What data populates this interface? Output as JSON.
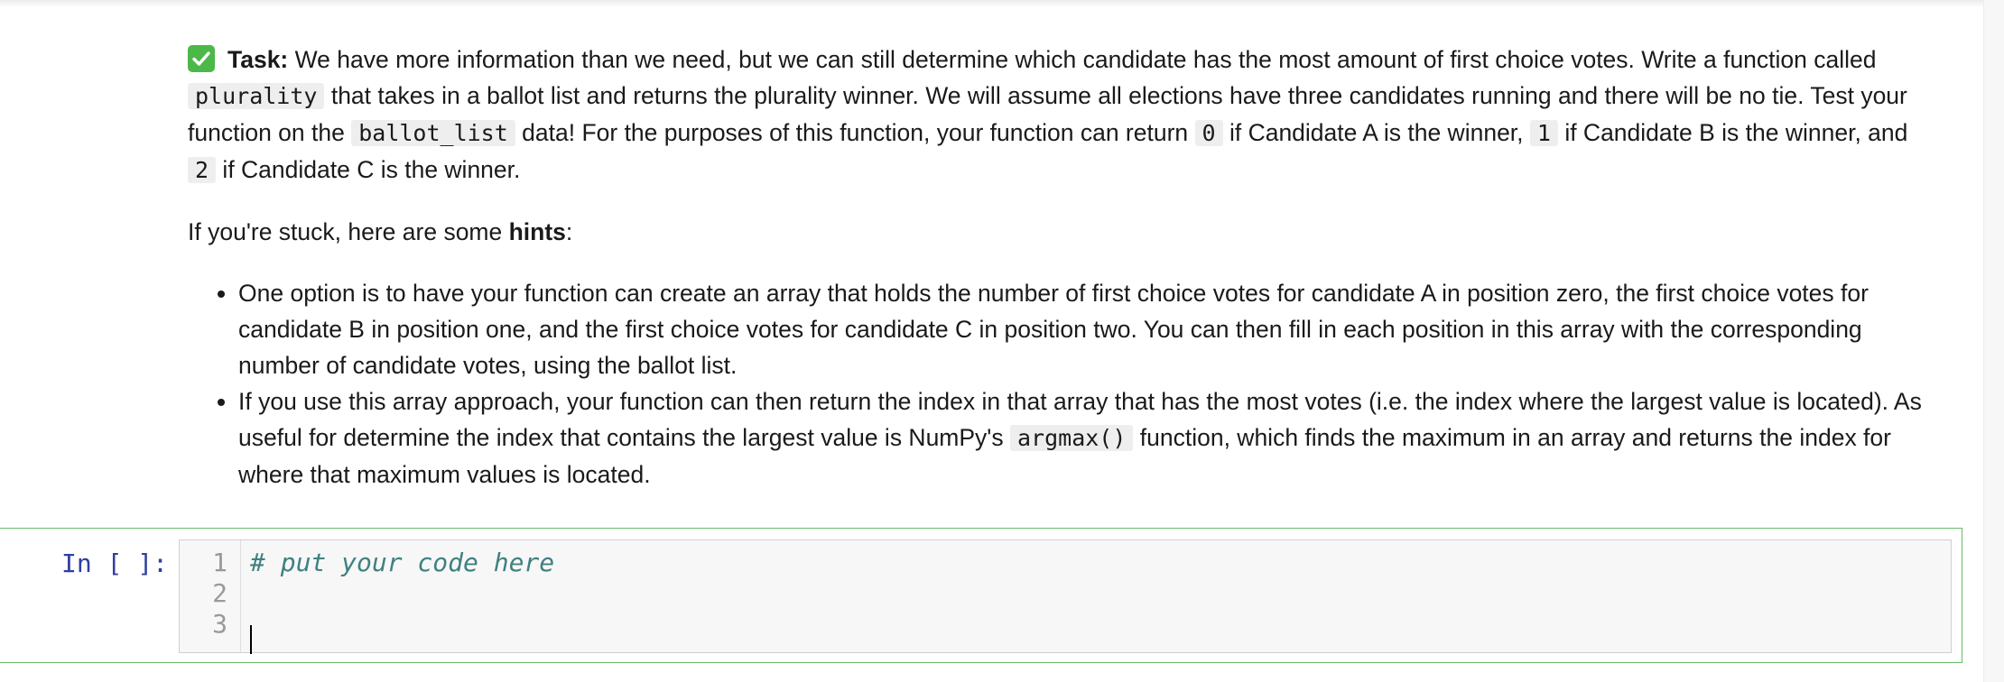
{
  "markdown": {
    "task_label": "Task:",
    "task_t1": " We have more information than we need, but we can still determine which candidate has the most amount of first choice votes. Write a function called ",
    "task_code1": "plurality",
    "task_t2": " that takes in a ballot list and returns the plurality winner. We will assume all elections have three candidates running and there will be no tie. Test your function on the ",
    "task_code2": "ballot_list",
    "task_t3": " data! For the purposes of this function, your function can return ",
    "task_code3": "0",
    "task_t4": " if Candidate A is the winner, ",
    "task_code4": "1",
    "task_t5": " if Candidate B is the winner, and ",
    "task_code5": "2",
    "task_t6": " if Candidate C is the winner.",
    "stuck_t1": "If you're stuck, here are some ",
    "stuck_bold": "hints",
    "stuck_t2": ":",
    "hint1": "One option is to have your function can create an array that holds the number of first choice votes for candidate A in position zero, the first choice votes for candidate B in position one, and the first choice votes for candidate C in position two. You can then fill in each position in this array with the corresponding number of candidate votes, using the ballot list.",
    "hint2_t1": "If you use this array approach, your function can then return the index in that array that has the most votes (i.e. the index where the largest value is located). As useful for determine the index that contains the largest value is NumPy's ",
    "hint2_code": "argmax()",
    "hint2_t2": " function, which finds the maximum in an array and returns the index for where that maximum values is located."
  },
  "code_cell": {
    "prompt": "In [ ]:",
    "line_numbers": [
      "1",
      "2",
      "3"
    ],
    "lines": [
      "# put your code here",
      "",
      ""
    ]
  },
  "colors": {
    "check_icon": "#4cb84a",
    "cell_border": "#66bb6a",
    "prompt": "#303f9f",
    "comment": "#408080"
  }
}
